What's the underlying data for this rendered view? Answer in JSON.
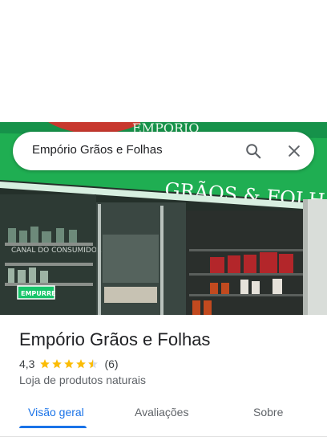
{
  "search": {
    "query": "Empório Grãos e Folhas"
  },
  "icons": {
    "search": "search-icon",
    "close": "close-icon"
  },
  "photo": {
    "sign_text": "GRÃOS & FOLHAS",
    "sign_top_text": "EMPÓRIO",
    "sticker_text": "EMPURRE",
    "shelf_text": "CANAL DO CONSUMIDOR"
  },
  "place": {
    "name": "Empório Grãos e Folhas",
    "rating": "4,3",
    "rating_value": 4.3,
    "review_count": "(6)",
    "category": "Loja de produtos naturais"
  },
  "tabs": [
    {
      "label": "Visão geral",
      "active": true
    },
    {
      "label": "Avaliações",
      "active": false
    },
    {
      "label": "Sobre",
      "active": false
    }
  ],
  "colors": {
    "accent": "#1a73e8",
    "star": "#fbbc04",
    "sign_green": "#1fae52"
  }
}
